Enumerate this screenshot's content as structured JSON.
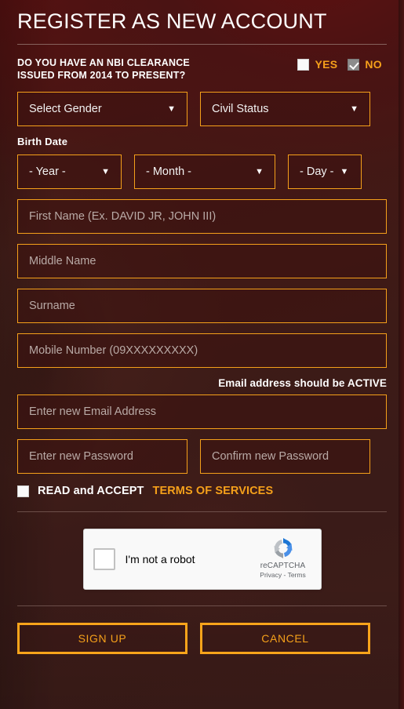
{
  "header": {
    "title": "REGISTER AS NEW ACCOUNT"
  },
  "nbi_question": {
    "line1": "DO YOU HAVE AN NBI CLEARANCE",
    "line2": "ISSUED FROM 2014 TO PRESENT?",
    "yes_label": "YES",
    "no_label": "NO",
    "yes_checked": "false",
    "no_checked": "true"
  },
  "selects": {
    "gender": {
      "value": "Select Gender",
      "caret": "▼"
    },
    "civil_status": {
      "value": "Civil Status",
      "caret": "▼"
    },
    "birth_date_label": "Birth Date",
    "year": {
      "value": "- Year -",
      "caret": "▼"
    },
    "month": {
      "value": "- Month -",
      "caret": "▼"
    },
    "day": {
      "value": "- Day -",
      "caret": "▼"
    }
  },
  "inputs": {
    "first_name": {
      "placeholder": "First Name (Ex. DAVID JR, JOHN III)",
      "value": ""
    },
    "middle_name": {
      "placeholder": "Middle Name",
      "value": ""
    },
    "surname": {
      "placeholder": "Surname",
      "value": ""
    },
    "mobile": {
      "placeholder": "Mobile Number (09XXXXXXXXX)",
      "value": ""
    },
    "email": {
      "placeholder": "Enter new Email Address",
      "value": ""
    },
    "password": {
      "placeholder": "Enter new Password",
      "value": ""
    },
    "confirm_password": {
      "placeholder": "Confirm new Password",
      "value": ""
    }
  },
  "email_note": "Email address should be ACTIVE",
  "terms": {
    "checked": "false",
    "text": "READ and ACCEPT",
    "link": "TERMS OF SERVICES"
  },
  "recaptcha": {
    "label": "I'm not a robot",
    "brand": "reCAPTCHA",
    "legal": "Privacy - Terms",
    "checked": "false"
  },
  "buttons": {
    "signup": "SIGN UP",
    "cancel": "CANCEL"
  },
  "colors": {
    "accent_orange": "#f5a01a",
    "background_maroon": "#3d1b17",
    "text_white": "#ffffff",
    "placeholder_gray": "#b9aaa6"
  }
}
